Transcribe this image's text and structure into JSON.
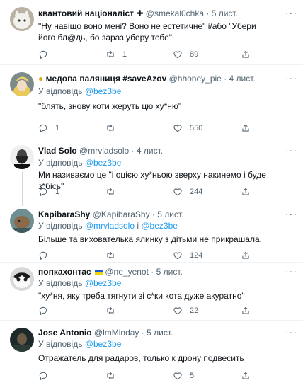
{
  "tweets": [
    {
      "name": "квантовий націоналіст ✚",
      "handle": "@smekal0chka",
      "time": "· 5 лист.",
      "reply_to": "",
      "mention": "",
      "mention2": "",
      "text": "\"Ну навіщо воно мені? Воно не естетичне\" і/або \"Убери його бл@дь, бо зараз уберу тебе\"",
      "replies": "",
      "retweets": "1",
      "likes": "89",
      "avatar": "avatar-white-cat"
    },
    {
      "name": "медова паляниця #saveAzov",
      "handle": "@hhoney_pie",
      "time": "· 4 лист.",
      "reply_to": "У відповідь",
      "mention": "@bez3be",
      "mention2": "",
      "text": "\"блять, знову коти жеруть цю ху*ню\"",
      "replies": "1",
      "retweets": "",
      "likes": "550",
      "avatar": "avatar-anime"
    },
    {
      "name": "Vlad Solo",
      "handle": "@mrvladsolo",
      "time": "· 4 лист.",
      "reply_to": "У відповідь",
      "mention": "@bez3be",
      "mention2": "",
      "text": "Ми називаємо це \"і оцією ху*ньою зверху накинемо і буде з*бісь\"",
      "replies": "1",
      "retweets": "",
      "likes": "244",
      "avatar": "avatar-bearded-man"
    },
    {
      "name": "KapibaraShy",
      "handle": "@KapibaraShy",
      "time": "· 5 лист.",
      "reply_to": "У відповідь",
      "mention": "@mrvladsolo",
      "mention2": "@bez3be",
      "text": "Більше та вихователька ялинку з дітьми не прикрашала.",
      "replies": "",
      "retweets": "",
      "likes": "124",
      "avatar": "avatar-capybara"
    },
    {
      "name": "попкахонтас",
      "handle": "@ne_yenot",
      "time": "· 5 лист.",
      "reply_to": "У відповідь",
      "mention": "@bez3be",
      "mention2": "",
      "text": "\"ху*ня, яку треба тягнути зі с*ки кота дуже акуратно\"",
      "replies": "",
      "retweets": "",
      "likes": "22",
      "avatar": "avatar-black-white-cat"
    },
    {
      "name": "Jose Antonio",
      "handle": "@lmMinday",
      "time": "· 5 лист.",
      "reply_to": "У відповідь",
      "mention": "@bez3be",
      "mention2": "",
      "text": "Отражатель для радаров, только к дрону подвесить",
      "replies": "",
      "retweets": "",
      "likes": "5",
      "avatar": "avatar-dark-photo"
    }
  ],
  "connector": "і",
  "icons": {
    "reply": "reply-icon",
    "retweet": "retweet-icon",
    "like": "heart-icon",
    "share": "share-icon",
    "more": "more-icon",
    "verified": "blue-yellow-flag-icon"
  },
  "colors": {
    "text": "#0f1419",
    "secondary": "#536471",
    "link": "#1d9bf0",
    "divider": "#eff3f4"
  }
}
